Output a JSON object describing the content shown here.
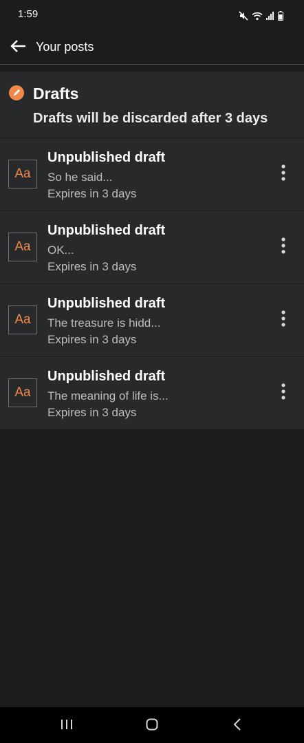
{
  "status_bar": {
    "time": "1:59",
    "icons": [
      "mute-icon",
      "wifi-icon",
      "signal-icon",
      "battery-icon"
    ]
  },
  "app_bar": {
    "back_icon": "arrow-left-icon",
    "title": "Your posts"
  },
  "drafts_section": {
    "icon": "pencil-icon",
    "title": "Drafts",
    "subtitle": "Drafts will be discarded after 3 days"
  },
  "drafts": [
    {
      "thumb": "Aa",
      "title": "Unpublished draft",
      "snippet": "So he said...",
      "expiry": "Expires in 3 days"
    },
    {
      "thumb": "Aa",
      "title": "Unpublished draft",
      "snippet": "OK...",
      "expiry": "Expires in 3 days"
    },
    {
      "thumb": "Aa",
      "title": "Unpublished draft",
      "snippet": "The treasure is hidd...",
      "expiry": "Expires in 3 days"
    },
    {
      "thumb": "Aa",
      "title": "Unpublished draft",
      "snippet": "The meaning of life is...",
      "expiry": "Expires in 3 days"
    }
  ],
  "nav_bar": {
    "buttons": [
      "recent-apps-icon",
      "home-icon",
      "back-icon"
    ]
  },
  "colors": {
    "background": "#1b1c1e",
    "card": "#28292b",
    "accent": "#f0884a"
  }
}
